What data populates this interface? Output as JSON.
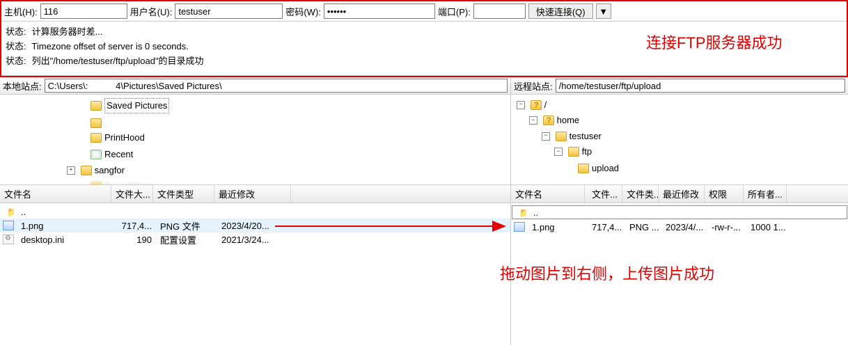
{
  "conn": {
    "host_label": "主机(H):",
    "host_value": "116",
    "user_label": "用户名(U):",
    "user_value": "testuser",
    "pass_label": "密码(W):",
    "pass_value": "••••••",
    "port_label": "端口(P):",
    "port_value": "",
    "quick_label": "快速连接(Q)",
    "drop_glyph": "▼"
  },
  "status": {
    "label": "状态:",
    "lines": [
      "计算服务器时差...",
      "Timezone offset of server is 0 seconds.",
      "列出\"/home/testuser/ftp/upload\"的目录成功"
    ]
  },
  "site": {
    "local_label": "本地站点:",
    "local_path": "C:\\Users\\:           4\\Pictures\\Saved Pictures\\",
    "remote_label": "远程站点:",
    "remote_path": "/home/testuser/ftp/upload"
  },
  "local_tree": {
    "nodes": [
      {
        "name": "Saved Pictures",
        "icon": "folder",
        "sel": true,
        "exp": "blank"
      },
      {
        "name": "",
        "icon": "folder",
        "blur": true,
        "exp": "blank"
      },
      {
        "name": "PrintHood",
        "icon": "folder",
        "exp": "blank"
      },
      {
        "name": "Recent",
        "icon": "recent",
        "exp": "blank"
      },
      {
        "name": "sangfor",
        "icon": "folder",
        "exp": "plus"
      },
      {
        "name": "Saved Games",
        "icon": "folder",
        "exp": "blank",
        "blur": true
      }
    ]
  },
  "remote_tree": {
    "root": "/",
    "l1": "home",
    "l2": "testuser",
    "l3": "ftp",
    "l4": "upload"
  },
  "local_files": {
    "headers": [
      "文件名",
      "文件大...",
      "文件类型",
      "最近修改"
    ],
    "updir": "..",
    "rows": [
      {
        "name": "1.png",
        "size": "717,4...",
        "type": "PNG 文件",
        "mod": "2023/4/20...",
        "icon": "png",
        "sel": true
      },
      {
        "name": "desktop.ini",
        "size": "190",
        "type": "配置设置",
        "mod": "2021/3/24...",
        "icon": "ini"
      }
    ]
  },
  "remote_files": {
    "headers": [
      "文件名",
      "文件...",
      "文件类...",
      "最近修改",
      "权限",
      "所有者..."
    ],
    "updir": "..",
    "rows": [
      {
        "name": "1.png",
        "size": "717,4...",
        "type": "PNG ...",
        "mod": "2023/4/...",
        "perm": "-rw-r-...",
        "own": "1000 1...",
        "icon": "png"
      }
    ]
  },
  "annotations": {
    "n1": "连接FTP服务器成功",
    "n2": "拖动图片到右侧，上传图片成功"
  }
}
